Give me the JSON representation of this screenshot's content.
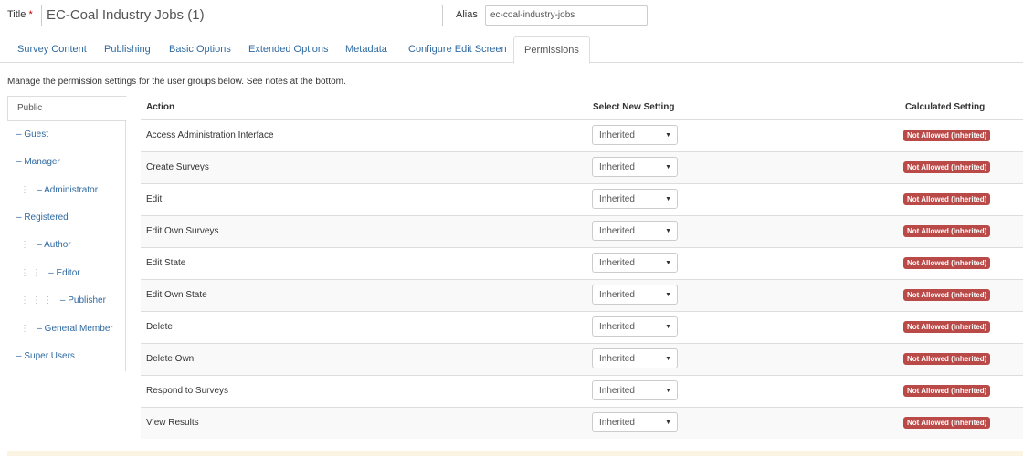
{
  "form": {
    "title_label": "Title",
    "required_mark": "*",
    "title_value": "EC-Coal Industry Jobs (1)",
    "alias_label": "Alias",
    "alias_value": "ec-coal-industry-jobs"
  },
  "tabs": [
    {
      "label": "Survey Content"
    },
    {
      "label": "Publishing"
    },
    {
      "label": "Basic Options"
    },
    {
      "label": "Extended Options"
    },
    {
      "label": "Metadata"
    },
    {
      "label": "Configure Edit Screen"
    },
    {
      "label": "Permissions",
      "active": true
    }
  ],
  "note": "Manage the permission settings for the user groups below. See notes at the bottom.",
  "groups": [
    {
      "label": "Public",
      "dots": "",
      "active": true
    },
    {
      "label": "– Guest",
      "dots": ""
    },
    {
      "label": "– Manager",
      "dots": ""
    },
    {
      "label": "– Administrator",
      "dots": "⋮"
    },
    {
      "label": "– Registered",
      "dots": ""
    },
    {
      "label": "– Author",
      "dots": "⋮"
    },
    {
      "label": "– Editor",
      "dots": "⋮ ⋮"
    },
    {
      "label": "– Publisher",
      "dots": "⋮ ⋮ ⋮"
    },
    {
      "label": "– General Member",
      "dots": "⋮"
    },
    {
      "label": "– Super Users",
      "dots": ""
    }
  ],
  "table": {
    "headers": {
      "action": "Action",
      "select": "Select New Setting",
      "calculated": "Calculated Setting"
    },
    "select_value": "Inherited",
    "badge_text": "Not Allowed (Inherited)",
    "badge_color": "#b94a48",
    "rows": [
      {
        "action": "Access Administration Interface"
      },
      {
        "action": "Create Surveys"
      },
      {
        "action": "Edit"
      },
      {
        "action": "Edit Own Surveys"
      },
      {
        "action": "Edit State"
      },
      {
        "action": "Edit Own State"
      },
      {
        "action": "Delete"
      },
      {
        "action": "Delete Own"
      },
      {
        "action": "Respond to Surveys"
      },
      {
        "action": "View Results"
      }
    ]
  },
  "colors": {
    "link": "#2f6aa0",
    "border": "#dddddd",
    "stripe": "#f9f9f9"
  }
}
